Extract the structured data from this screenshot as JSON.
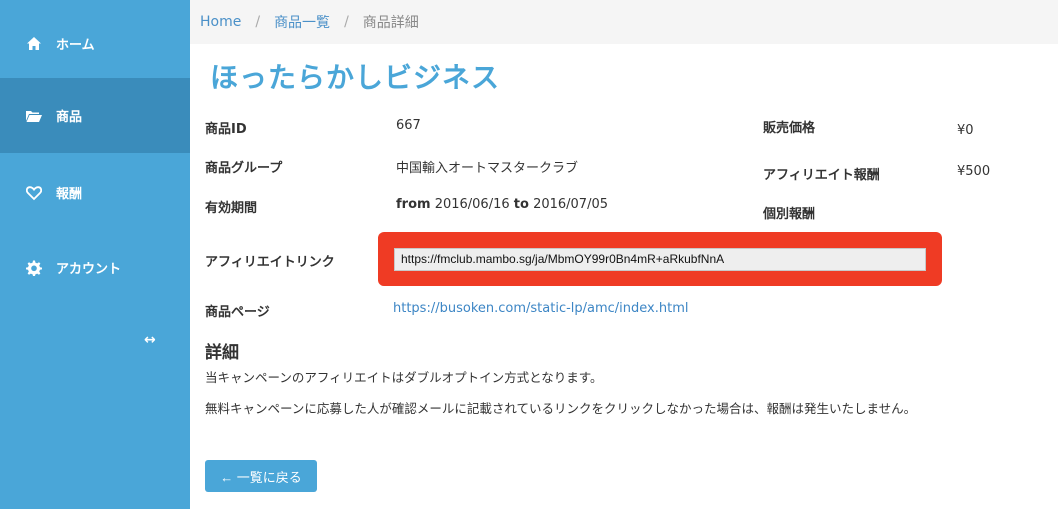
{
  "sidebar": {
    "items": [
      {
        "label": "ホーム",
        "icon": "home-icon"
      },
      {
        "label": "商品",
        "icon": "folder-open-icon"
      },
      {
        "label": "報酬",
        "icon": "heart-icon"
      },
      {
        "label": "アカウント",
        "icon": "gear-icon"
      }
    ],
    "expand_glyph": "↔"
  },
  "breadcrumb": {
    "home": "Home",
    "sep": "/",
    "list": "商品一覧",
    "current": "商品詳細"
  },
  "title": "ほったらかしビジネス",
  "fields": {
    "product_id_label": "商品ID",
    "product_id_value": "667",
    "group_label": "商品グループ",
    "group_value": "中国輸入オートマスタークラブ",
    "period_label": "有効期間",
    "period_from_word": "from",
    "period_from": "2016/06/16",
    "period_to_word": "to",
    "period_to": "2016/07/05",
    "price_label": "販売価格",
    "price_value": "¥0",
    "reward_label": "アフィリエイト報酬",
    "reward_value": "¥500",
    "individual_label": "個別報酬",
    "link_label": "アフィリエイトリンク",
    "link_value": "https://fmclub.mambo.sg/ja/MbmOY99r0Bn4mR+aRkubfNnA",
    "page_label": "商品ページ",
    "page_url": "https://busoken.com/static-lp/amc/index.html"
  },
  "details": {
    "heading": "詳細",
    "line1": "当キャンペーンのアフィリエイトはダブルオプトイン方式となります。",
    "line2": "無料キャンペーンに応募した人が確認メールに記載されているリンクをクリックしなかった場合は、報酬は発生いたしません。"
  },
  "back_button": "← 一覧に戻る",
  "colors": {
    "sidebar": "#4aa6d8",
    "sidebar_active": "#3a8cbb",
    "highlight": "#ef3b24",
    "link": "#3d86c5"
  }
}
